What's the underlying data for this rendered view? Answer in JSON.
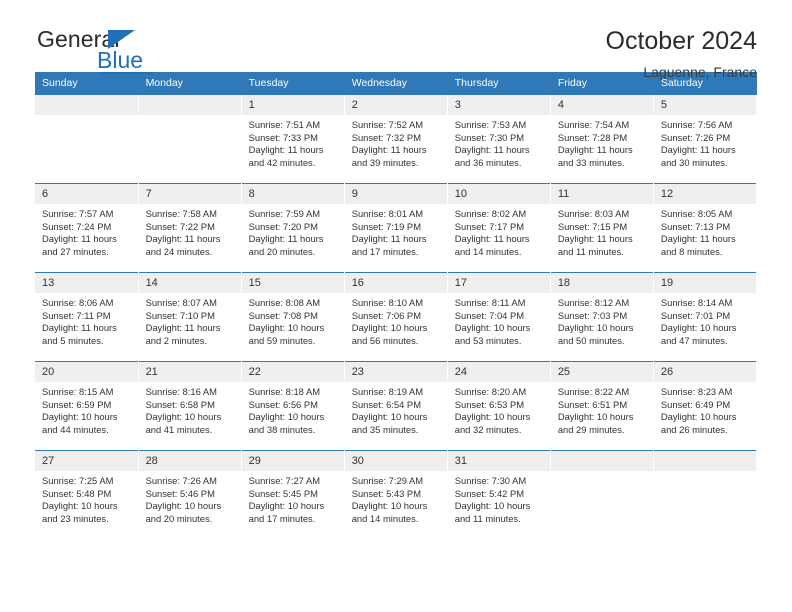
{
  "logo": {
    "word_top": "General",
    "word_bottom": "Blue",
    "accent_color": "#1f70b8"
  },
  "header": {
    "title": "October 2024",
    "subtitle": "Laguenne, France"
  },
  "theme": {
    "header_blue": "#3079b8",
    "daynum_band": "#efeff0",
    "text": "#333333"
  },
  "weekday_headers": [
    "Sunday",
    "Monday",
    "Tuesday",
    "Wednesday",
    "Thursday",
    "Friday",
    "Saturday"
  ],
  "labels": {
    "sunrise_prefix": "Sunrise:",
    "sunset_prefix": "Sunset:",
    "daylight_prefix": "Daylight:"
  },
  "weeks": [
    [
      {
        "day": "",
        "empty": true
      },
      {
        "day": "",
        "empty": true
      },
      {
        "day": "1",
        "sunrise": "Sunrise: 7:51 AM",
        "sunset": "Sunset: 7:33 PM",
        "daylight": "Daylight: 11 hours and 42 minutes."
      },
      {
        "day": "2",
        "sunrise": "Sunrise: 7:52 AM",
        "sunset": "Sunset: 7:32 PM",
        "daylight": "Daylight: 11 hours and 39 minutes."
      },
      {
        "day": "3",
        "sunrise": "Sunrise: 7:53 AM",
        "sunset": "Sunset: 7:30 PM",
        "daylight": "Daylight: 11 hours and 36 minutes."
      },
      {
        "day": "4",
        "sunrise": "Sunrise: 7:54 AM",
        "sunset": "Sunset: 7:28 PM",
        "daylight": "Daylight: 11 hours and 33 minutes."
      },
      {
        "day": "5",
        "sunrise": "Sunrise: 7:56 AM",
        "sunset": "Sunset: 7:26 PM",
        "daylight": "Daylight: 11 hours and 30 minutes."
      }
    ],
    [
      {
        "day": "6",
        "sunrise": "Sunrise: 7:57 AM",
        "sunset": "Sunset: 7:24 PM",
        "daylight": "Daylight: 11 hours and 27 minutes."
      },
      {
        "day": "7",
        "sunrise": "Sunrise: 7:58 AM",
        "sunset": "Sunset: 7:22 PM",
        "daylight": "Daylight: 11 hours and 24 minutes."
      },
      {
        "day": "8",
        "sunrise": "Sunrise: 7:59 AM",
        "sunset": "Sunset: 7:20 PM",
        "daylight": "Daylight: 11 hours and 20 minutes."
      },
      {
        "day": "9",
        "sunrise": "Sunrise: 8:01 AM",
        "sunset": "Sunset: 7:19 PM",
        "daylight": "Daylight: 11 hours and 17 minutes."
      },
      {
        "day": "10",
        "sunrise": "Sunrise: 8:02 AM",
        "sunset": "Sunset: 7:17 PM",
        "daylight": "Daylight: 11 hours and 14 minutes."
      },
      {
        "day": "11",
        "sunrise": "Sunrise: 8:03 AM",
        "sunset": "Sunset: 7:15 PM",
        "daylight": "Daylight: 11 hours and 11 minutes."
      },
      {
        "day": "12",
        "sunrise": "Sunrise: 8:05 AM",
        "sunset": "Sunset: 7:13 PM",
        "daylight": "Daylight: 11 hours and 8 minutes."
      }
    ],
    [
      {
        "day": "13",
        "sunrise": "Sunrise: 8:06 AM",
        "sunset": "Sunset: 7:11 PM",
        "daylight": "Daylight: 11 hours and 5 minutes."
      },
      {
        "day": "14",
        "sunrise": "Sunrise: 8:07 AM",
        "sunset": "Sunset: 7:10 PM",
        "daylight": "Daylight: 11 hours and 2 minutes."
      },
      {
        "day": "15",
        "sunrise": "Sunrise: 8:08 AM",
        "sunset": "Sunset: 7:08 PM",
        "daylight": "Daylight: 10 hours and 59 minutes."
      },
      {
        "day": "16",
        "sunrise": "Sunrise: 8:10 AM",
        "sunset": "Sunset: 7:06 PM",
        "daylight": "Daylight: 10 hours and 56 minutes."
      },
      {
        "day": "17",
        "sunrise": "Sunrise: 8:11 AM",
        "sunset": "Sunset: 7:04 PM",
        "daylight": "Daylight: 10 hours and 53 minutes."
      },
      {
        "day": "18",
        "sunrise": "Sunrise: 8:12 AM",
        "sunset": "Sunset: 7:03 PM",
        "daylight": "Daylight: 10 hours and 50 minutes."
      },
      {
        "day": "19",
        "sunrise": "Sunrise: 8:14 AM",
        "sunset": "Sunset: 7:01 PM",
        "daylight": "Daylight: 10 hours and 47 minutes."
      }
    ],
    [
      {
        "day": "20",
        "sunrise": "Sunrise: 8:15 AM",
        "sunset": "Sunset: 6:59 PM",
        "daylight": "Daylight: 10 hours and 44 minutes."
      },
      {
        "day": "21",
        "sunrise": "Sunrise: 8:16 AM",
        "sunset": "Sunset: 6:58 PM",
        "daylight": "Daylight: 10 hours and 41 minutes."
      },
      {
        "day": "22",
        "sunrise": "Sunrise: 8:18 AM",
        "sunset": "Sunset: 6:56 PM",
        "daylight": "Daylight: 10 hours and 38 minutes."
      },
      {
        "day": "23",
        "sunrise": "Sunrise: 8:19 AM",
        "sunset": "Sunset: 6:54 PM",
        "daylight": "Daylight: 10 hours and 35 minutes."
      },
      {
        "day": "24",
        "sunrise": "Sunrise: 8:20 AM",
        "sunset": "Sunset: 6:53 PM",
        "daylight": "Daylight: 10 hours and 32 minutes."
      },
      {
        "day": "25",
        "sunrise": "Sunrise: 8:22 AM",
        "sunset": "Sunset: 6:51 PM",
        "daylight": "Daylight: 10 hours and 29 minutes."
      },
      {
        "day": "26",
        "sunrise": "Sunrise: 8:23 AM",
        "sunset": "Sunset: 6:49 PM",
        "daylight": "Daylight: 10 hours and 26 minutes."
      }
    ],
    [
      {
        "day": "27",
        "sunrise": "Sunrise: 7:25 AM",
        "sunset": "Sunset: 5:48 PM",
        "daylight": "Daylight: 10 hours and 23 minutes."
      },
      {
        "day": "28",
        "sunrise": "Sunrise: 7:26 AM",
        "sunset": "Sunset: 5:46 PM",
        "daylight": "Daylight: 10 hours and 20 minutes."
      },
      {
        "day": "29",
        "sunrise": "Sunrise: 7:27 AM",
        "sunset": "Sunset: 5:45 PM",
        "daylight": "Daylight: 10 hours and 17 minutes."
      },
      {
        "day": "30",
        "sunrise": "Sunrise: 7:29 AM",
        "sunset": "Sunset: 5:43 PM",
        "daylight": "Daylight: 10 hours and 14 minutes."
      },
      {
        "day": "31",
        "sunrise": "Sunrise: 7:30 AM",
        "sunset": "Sunset: 5:42 PM",
        "daylight": "Daylight: 10 hours and 11 minutes."
      },
      {
        "day": "",
        "empty": true
      },
      {
        "day": "",
        "empty": true
      }
    ]
  ]
}
